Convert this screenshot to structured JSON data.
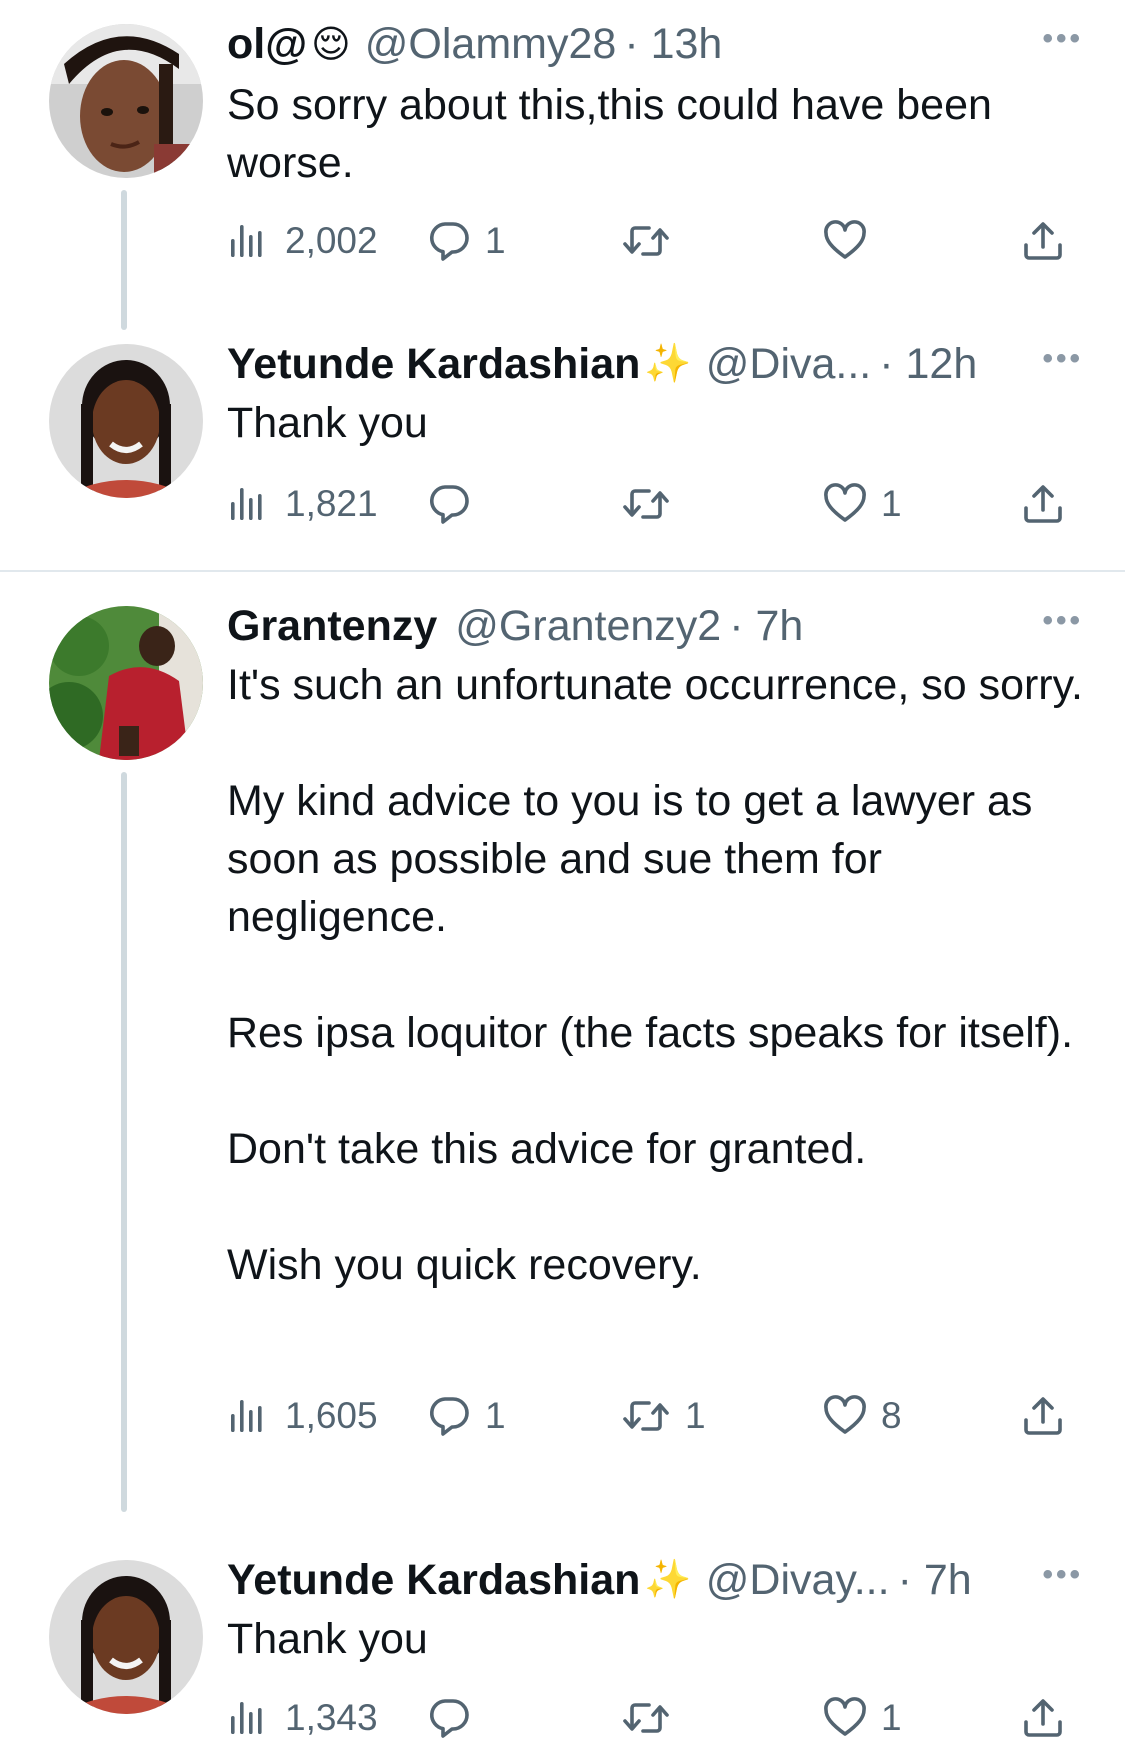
{
  "colors": {
    "text": "#0f1419",
    "secondary": "#536471",
    "thread_line": "#cfd9de",
    "divider": "#e1e8ed"
  },
  "icons": {
    "views": "bar-chart-icon",
    "reply": "speech-bubble-icon",
    "retweet": "retweet-icon",
    "like": "heart-icon",
    "share": "share-icon",
    "more": "ellipsis-icon"
  },
  "tweets": [
    {
      "name": "ol@",
      "emoji": "😌",
      "handle": "@Olammy28",
      "time": "· 13h",
      "text": "So sorry about this,this could have been worse.",
      "views": "2,002",
      "replies": "1",
      "retweets": "",
      "likes": ""
    },
    {
      "name": "Yetunde Kardashian",
      "emoji": "✨",
      "handle": "@Diva...",
      "time": "· 12h",
      "text": "Thank you",
      "views": "1,821",
      "replies": "",
      "retweets": "",
      "likes": "1"
    },
    {
      "name": "Grantenzy",
      "emoji": "",
      "handle": "@Grantenzy2",
      "time": "· 7h",
      "text": "It's such an unfortunate occurrence, so sorry.\n\nMy kind advice to you is to get a lawyer as soon as possible and sue them for negligence.\n\nRes ipsa loquitor (the facts speaks for itself).\n\nDon't take this advice for granted.\n\nWish you quick recovery.",
      "views": "1,605",
      "replies": "1",
      "retweets": "1",
      "likes": "8"
    },
    {
      "name": "Yetunde Kardashian",
      "emoji": "✨",
      "handle": "@Divay...",
      "time": "· 7h",
      "text": "Thank you",
      "views": "1,343",
      "replies": "",
      "retweets": "",
      "likes": "1"
    }
  ]
}
